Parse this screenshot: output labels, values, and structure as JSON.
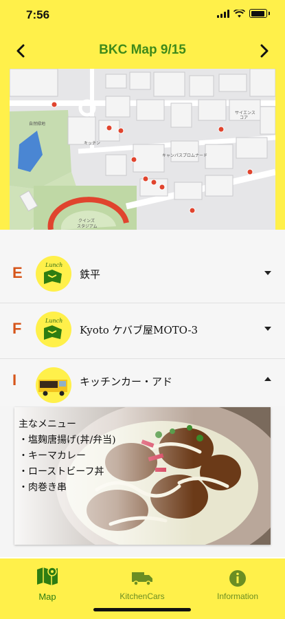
{
  "status": {
    "time": "7:56"
  },
  "header": {
    "title": "BKC Map 9/15"
  },
  "map": {
    "labels": {
      "natural_park": "自然緑地",
      "campus_promenade": "キャンパスプロムナード",
      "queens_stadium": "クインズ\nスタジアム",
      "science_core": "サイエンス\nコア",
      "co_kitchen": "キッチン"
    }
  },
  "list": [
    {
      "letter": "E",
      "name": "鉄平",
      "expanded": false
    },
    {
      "letter": "F",
      "name": "Kyoto ケバブ屋MOTO-3",
      "expanded": false
    },
    {
      "letter": "I",
      "name": "キッチンカー・アド",
      "expanded": true
    }
  ],
  "menu": {
    "heading": "主なメニュー",
    "items": [
      "・塩麹唐揚げ(丼/弁当)",
      "・キーマカレー",
      "・ローストビーフ丼",
      "・肉巻き串"
    ]
  },
  "tabs": [
    {
      "label": "Map",
      "active": true
    },
    {
      "label": "KitchenCars",
      "active": false
    },
    {
      "label": "Information",
      "active": false
    }
  ],
  "colors": {
    "accent_yellow": "#fff04a",
    "title_green": "#3f8a1a",
    "letter_orange": "#d6551a"
  }
}
